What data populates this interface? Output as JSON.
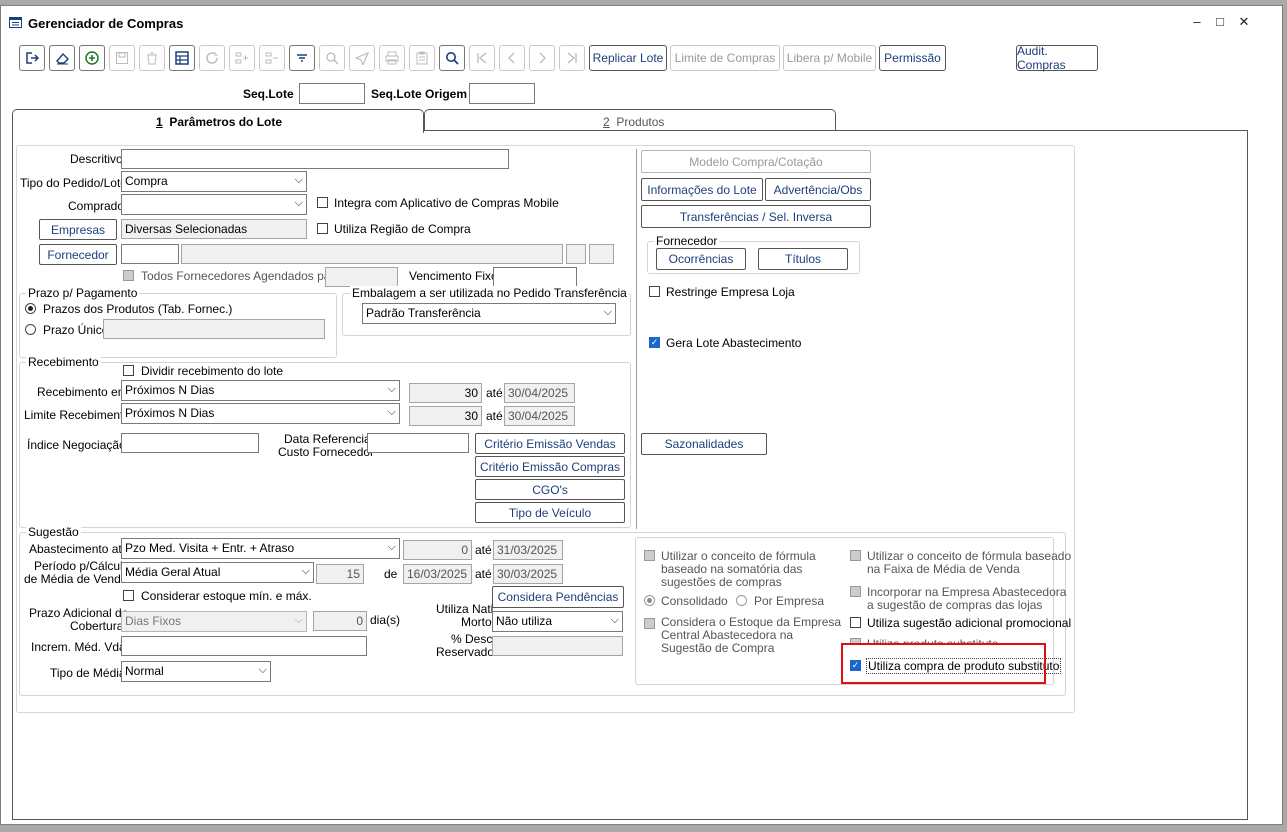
{
  "window": {
    "title": "Gerenciador de Compras",
    "controls": [
      "–",
      "□",
      "✕"
    ]
  },
  "toolbar": {
    "text_buttons": {
      "replicar_lote": "Replicar Lote",
      "limite_compras": "Limite de Compras",
      "libera_mobile": "Libera p/ Mobile",
      "permissao": "Permissão",
      "audit_compras": "Audit. Compras"
    }
  },
  "header": {
    "seq_lote_label": "Seq.Lote",
    "seq_lote_origem_label": "Seq.Lote Origem"
  },
  "tabs": [
    {
      "num": "1",
      "label": "Parâmetros do Lote"
    },
    {
      "num": "2",
      "label": "Produtos"
    }
  ],
  "form": {
    "descritivo_label": "Descritivo",
    "tipo_pedido_label": "Tipo do Pedido/Lote",
    "tipo_pedido_value": "Compra",
    "comprador_label": "Comprador",
    "integra_mobile_label": "Integra com Aplicativo de Compras Mobile",
    "empresas_button": "Empresas",
    "empresas_value": "Diversas Selecionadas",
    "utiliza_regiao_label": "Utiliza Região de Compra",
    "fornecedor_button": "Fornecedor",
    "todos_fornecedores_label": "Todos Fornecedores Agendados para",
    "vencimento_fixo_label": "Vencimento Fixo",
    "prazo_group_title": "Prazo p/ Pagamento",
    "prazos_produtos_label": "Prazos dos Produtos (Tab. Fornec.)",
    "prazo_unico_label": "Prazo Único",
    "embalagem_group_title": "Embalagem a ser utilizada no Pedido Transferência",
    "embalagem_value": "Padrão Transferência"
  },
  "recebimento": {
    "group_title": "Recebimento",
    "dividir_label": "Dividir recebimento do lote",
    "recebimento_em_label": "Recebimento em:",
    "recebimento_em_value": "Próximos N Dias",
    "recebimento_dias": "30",
    "recebimento_ate_label": "até",
    "recebimento_date": "30/04/2025",
    "limite_label": "Limite Recebimento:",
    "limite_value": "Próximos N Dias",
    "limite_dias": "30",
    "limite_ate_label": "até",
    "limite_date": "30/04/2025",
    "indice_label": "Índice Negociação",
    "data_ref_label_1": "Data Referencia",
    "data_ref_label_2": "Custo Fornecedor",
    "criterio_vendas_button": "Critério Emissão Vendas",
    "criterio_compras_button": "Critério Emissão Compras",
    "cgos_button": "CGO's",
    "tipo_veiculo_button": "Tipo de Veículo"
  },
  "right_panel": {
    "modelo_compra_button": "Modelo Compra/Cotação",
    "informacoes_lote_button": "Informações do Lote",
    "advertencia_button": "Advertência/Obs",
    "transferencias_button": "Transferências / Sel. Inversa",
    "fornecedor_group_title": "Fornecedor",
    "ocorrencias_button": "Ocorrências",
    "titulos_button": "Títulos",
    "restringe_label": "Restringe Empresa Loja",
    "gera_lote_label": "Gera Lote Abastecimento",
    "sazonalidades_button": "Sazonalidades"
  },
  "sugestao": {
    "group_title": "Sugestão",
    "abastecimento_label": "Abastecimento até",
    "abastecimento_value": "Pzo Med. Visita + Entr. + Atraso",
    "abastecimento_num": "0",
    "abastecimento_ate_label": "até",
    "abastecimento_date": "31/03/2025",
    "periodo_label_1": "Período p/Cálculo",
    "periodo_label_2": "de Média de Venda",
    "periodo_value": "Média Geral Atual",
    "periodo_num": "15",
    "periodo_de_label": "de",
    "periodo_de_date": "16/03/2025",
    "periodo_ate_label": "até",
    "periodo_ate_date": "30/03/2025",
    "considerar_estoque_label": "Considerar estoque mín. e máx.",
    "considera_pendencias_button": "Considera Pendências",
    "prazo_adicional_label_1": "Prazo Adicional de",
    "prazo_adicional_label_2": "Cobertura",
    "prazo_adicional_value": "Dias Fixos",
    "prazo_adicional_num": "0",
    "dias_label": "dia(s)",
    "nati_morto_label_1": "Utiliza Nati",
    "nati_morto_label_2": "Morto",
    "nati_morto_value": "Não utiliza",
    "increm_label": "Increm. Méd. Vda.",
    "desc_reservado_label_1": "% Desc.",
    "desc_reservado_label_2": "Reservado",
    "tipo_media_label": "Tipo de Média",
    "tipo_media_value": "Normal"
  },
  "sugestao_options": {
    "formula_somatoria_1": "Utilizar o conceito de fórmula",
    "formula_somatoria_2": "baseado na somatória das",
    "formula_somatoria_3": "sugestões de compras",
    "consolidado_label": "Consolidado",
    "por_empresa_label": "Por Empresa",
    "considera_estoque_1": "Considera o Estoque da Empresa",
    "considera_estoque_2": "Central Abastecedora na",
    "considera_estoque_3": "Sugestão de Compra",
    "formula_faixa_1": "Utilizar o conceito de fórmula baseado",
    "formula_faixa_2": "na Faixa de Média de Venda",
    "incorporar_1": "Incorporar na Empresa Abastecedora",
    "incorporar_2": "a sugestão de compras das lojas",
    "sugestao_promocional_label": "Utiliza sugestão adicional promocional",
    "produto_substituto_label": "Utiliza produto substituto",
    "compra_substituto_label": "Utiliza compra de produto substituto"
  },
  "highlight_color": "#e01010"
}
